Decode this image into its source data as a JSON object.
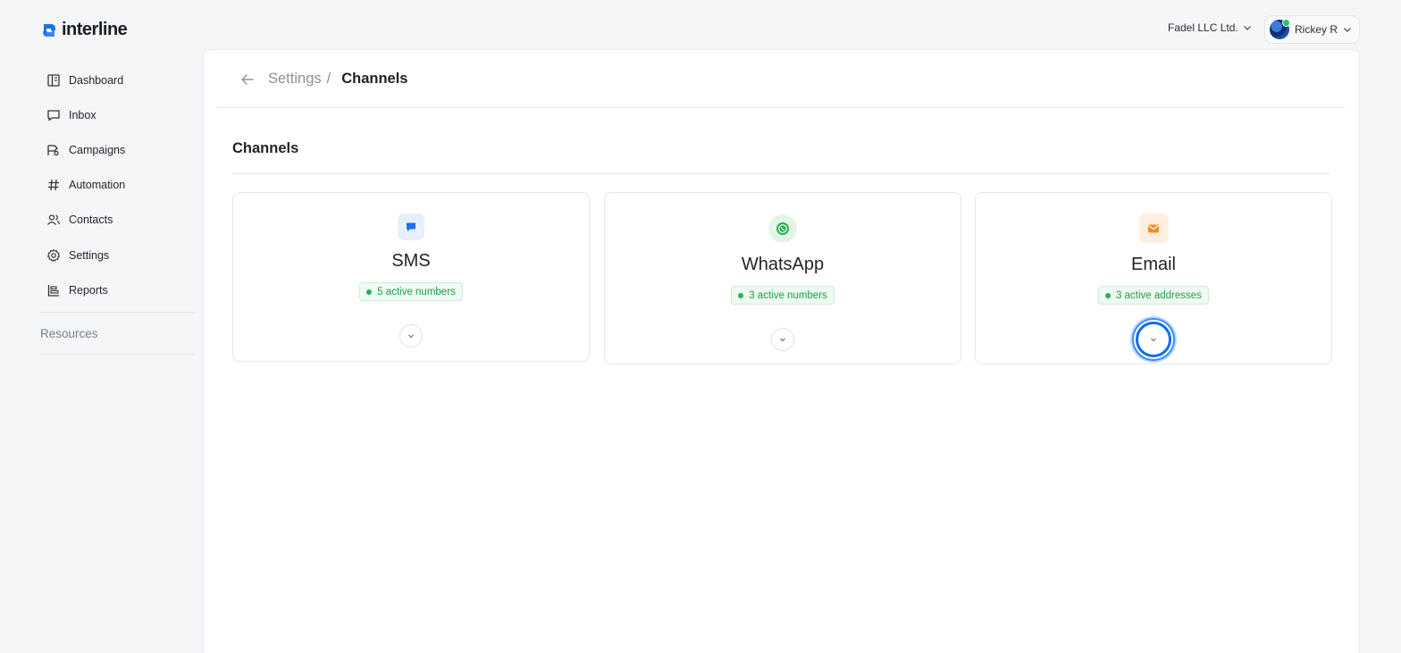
{
  "brand": {
    "name": "interline",
    "color": "#1a73e8"
  },
  "topbar": {
    "org": "Fadel LLC Ltd.",
    "user": "Rickey R"
  },
  "sidebar": {
    "items": [
      {
        "label": "Dashboard",
        "icon": "dashboard-icon"
      },
      {
        "label": "Inbox",
        "icon": "inbox-icon"
      },
      {
        "label": "Campaigns",
        "icon": "campaign-icon"
      },
      {
        "label": "Automation",
        "icon": "hash-icon"
      },
      {
        "label": "Contacts",
        "icon": "contacts-icon"
      },
      {
        "label": "Settings",
        "icon": "gear-icon"
      },
      {
        "label": "Reports",
        "icon": "reports-icon"
      }
    ],
    "resources": "Resources"
  },
  "breadcrumb": {
    "parent": "Settings",
    "separator": "/",
    "current": "Channels"
  },
  "section": {
    "title": "Channels"
  },
  "channels": [
    {
      "name": "SMS",
      "status": "5 active numbers",
      "icon": "chat-icon",
      "color": "#1a73e8"
    },
    {
      "name": "WhatsApp",
      "status": "3 active numbers",
      "icon": "whatsapp-icon",
      "color": "#25b04f"
    },
    {
      "name": "Email",
      "status": "3 active addresses",
      "icon": "mail-icon",
      "color": "#f08a24"
    }
  ],
  "colors": {
    "status_green": "#22b155",
    "focus_ring": "#0a6cf0"
  }
}
